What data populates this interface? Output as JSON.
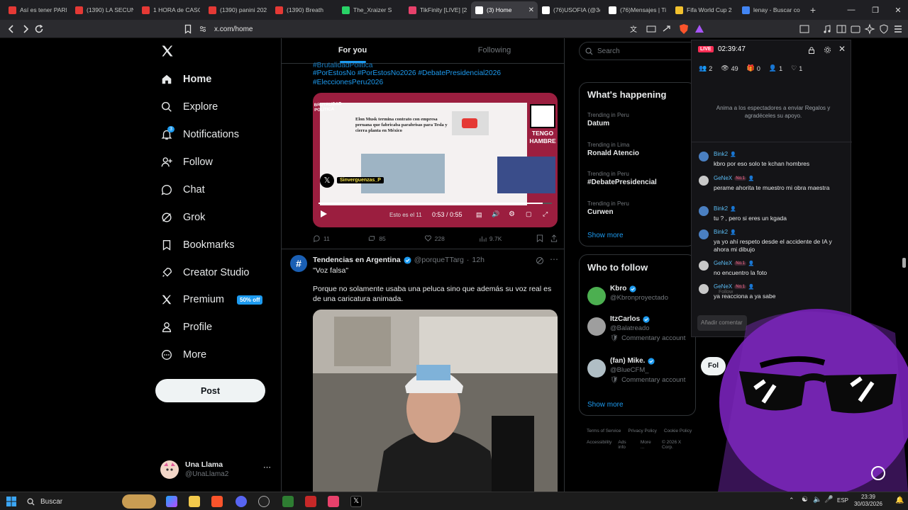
{
  "browser": {
    "tabs": [
      {
        "title": "Así es tener PARE",
        "icon": "youtube-icon",
        "color": "#e53935"
      },
      {
        "title": "(1390) LA SECUN",
        "icon": "youtube-icon",
        "color": "#e53935"
      },
      {
        "title": "1 HORA de CASO",
        "icon": "youtube-icon",
        "color": "#e53935"
      },
      {
        "title": "(1390) panini 202",
        "icon": "youtube-icon",
        "color": "#e53935"
      },
      {
        "title": "(1390) Breath",
        "icon": "youtube-icon",
        "color": "#e53935"
      },
      {
        "title": "The_Xraizer S",
        "icon": "tab-icon",
        "color": "#29d367"
      },
      {
        "title": "TikFinity [LIVE] [2",
        "icon": "tab-icon",
        "color": "#e8416b"
      },
      {
        "title": "(3) Home",
        "icon": "x-icon",
        "color": "#ffffff"
      },
      {
        "title": "(76)USOFIA (@3d",
        "icon": "tiktok-icon",
        "color": "#ffffff"
      },
      {
        "title": "(76)Mensajes | Ti",
        "icon": "tiktok-icon",
        "color": "#ffffff"
      },
      {
        "title": "Fifa World Cup 2",
        "icon": "tab-icon",
        "color": "#f2c12e"
      },
      {
        "title": "lenay - Buscar co",
        "icon": "google-icon",
        "color": "#4285f4"
      }
    ],
    "url": "x.com/home"
  },
  "nav": {
    "items": [
      {
        "label": "Home",
        "icon": "home-icon"
      },
      {
        "label": "Explore",
        "icon": "search-icon"
      },
      {
        "label": "Notifications",
        "icon": "bell-icon",
        "badge": "3"
      },
      {
        "label": "Follow",
        "icon": "follow-icon"
      },
      {
        "label": "Chat",
        "icon": "chat-icon"
      },
      {
        "label": "Grok",
        "icon": "grok-icon"
      },
      {
        "label": "Bookmarks",
        "icon": "bookmark-icon"
      },
      {
        "label": "Creator Studio",
        "icon": "rocket-icon"
      },
      {
        "label": "Premium",
        "icon": "x-icon",
        "tag": "50% off"
      },
      {
        "label": "Profile",
        "icon": "person-icon"
      },
      {
        "label": "More",
        "icon": "more-circle-icon"
      }
    ],
    "post": "Post",
    "account": {
      "name": "Una Llama",
      "handle": "@UnaLlama2"
    }
  },
  "feed": {
    "tabs": [
      "For you",
      "Following"
    ],
    "tweet1": {
      "hashtags_line1": "#BrutalidadPolitica",
      "hashtags_line2": "#PorEstosNo #PorEstosNo2026 #DebatePresidencial2026",
      "hashtags_line3": "#EleccionesPeru2026",
      "video": {
        "logo_text_1": "BRUTALIDAD",
        "logo_text_2": "POLÍTICA",
        "headline": "Elon Musk termina contrato con empresa peruana que fabricaba parabrisas para Tesla y cierra planta en México",
        "side_text": "TENGO HAMBRE",
        "user_tag": "Sinverguenzas_P",
        "time": "0:53 / 0:55",
        "subtitle": "Esto es el 11"
      },
      "stats": {
        "replies": "11",
        "reposts": "85",
        "likes": "228",
        "views": "9.7K"
      }
    },
    "tweet2": {
      "name": "Tendencias en Argentina",
      "handle": "@porqueTTarg",
      "time": "12h",
      "line1": "\"Voz falsa\"",
      "body": "Porque no solamente usaba una peluca sino que además su voz real es de una caricatura animada."
    }
  },
  "right": {
    "search_placeholder": "Search",
    "happening_title": "What's happening",
    "trends": [
      {
        "meta": "Trending in Peru",
        "name": "Datum"
      },
      {
        "meta": "Trending in Lima",
        "name": "Ronald Atencio"
      },
      {
        "meta": "Trending in Peru",
        "name": "#DebatePresidencial"
      },
      {
        "meta": "Trending in Peru",
        "name": "Curwen"
      }
    ],
    "show_more": "Show more",
    "who_title": "Who to follow",
    "who": [
      {
        "name": "Kbro",
        "handle": "@Kbronproyectado",
        "sub": ""
      },
      {
        "name": "ItzCarlos",
        "handle": "@Balatreado",
        "sub": "Commentary account"
      },
      {
        "name": "(fan) Mike.",
        "handle": "@BlueCFM_",
        "sub": "Commentary account"
      }
    ],
    "follow_btn": "Fol",
    "footer1": [
      "Terms of Service",
      "Privacy Policy",
      "Cookie Policy"
    ],
    "footer2": [
      "Accessibility",
      "Ads info",
      "More ...",
      "© 2026 X Corp."
    ]
  },
  "live": {
    "badge": "LIVE",
    "time": "02:39:47",
    "stats": {
      "users": "2",
      "viewers": "49",
      "gifts": "0",
      "follows": "1",
      "likes": "1"
    },
    "prompt": "Anima a los espectadores a enviar Regalos y agradéceles su apoyo.",
    "rank": "No.1",
    "chat": [
      {
        "name": "Bink2",
        "msg": "kbro por eso solo te kchan hombres",
        "no1": false
      },
      {
        "name": "GeNeX",
        "msg": "perame ahorita te muestro mi obra maestra",
        "no1": true
      },
      {
        "name": "Bink2",
        "msg": "tu ? , pero si eres un kgada",
        "no1": false
      },
      {
        "name": "Bink2",
        "msg": "ya yo ahí respeto desde el accidente de IA y ahora mi dibujo",
        "no1": false
      },
      {
        "name": "GeNeX",
        "msg": "no encuentro la foto",
        "no1": true
      },
      {
        "name": "GeNeX",
        "msg": "ya reacciona a ya sabe",
        "no1": true
      }
    ],
    "comment_placeholder": "Añadir comentar",
    "follow_ghost": "Follow"
  },
  "taskbar": {
    "search": "Buscar",
    "lang": "ESP",
    "time": "23:39",
    "date": "30/03/2026"
  },
  "colors": {
    "accent": "#1d9bf0",
    "live": "#ff2d55",
    "avatar_purple": "#6d1fa8"
  }
}
